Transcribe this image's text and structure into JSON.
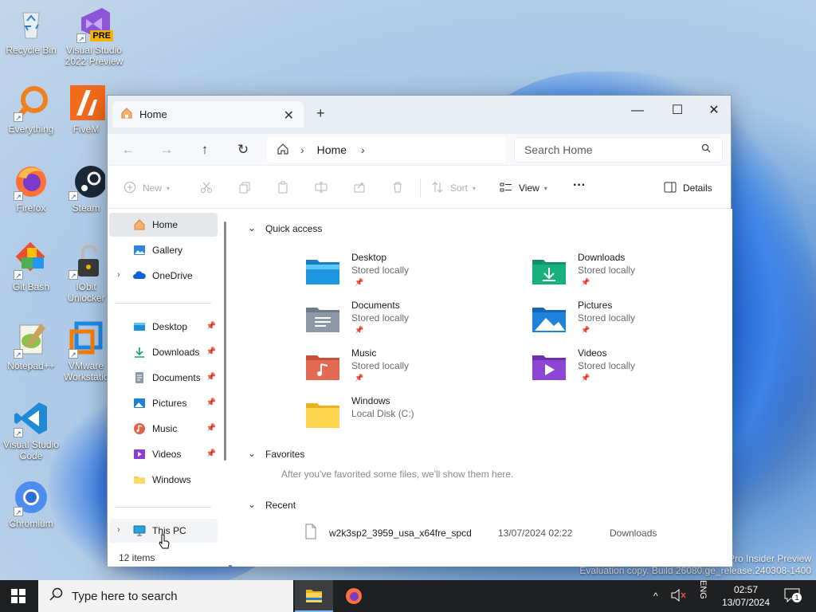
{
  "desktop": {
    "icons": [
      {
        "label": "Recycle Bin",
        "icon": "recycle-bin-icon"
      },
      {
        "label": "Visual Studio 2022 Preview",
        "icon": "visual-studio-icon",
        "badge": "PRE"
      },
      {
        "label": "Everything",
        "icon": "everything-icon"
      },
      {
        "label": "FiveM",
        "icon": "fivem-icon"
      },
      {
        "label": "Firefox",
        "icon": "firefox-icon"
      },
      {
        "label": "Steam",
        "icon": "steam-icon"
      },
      {
        "label": "Git Bash",
        "icon": "git-bash-icon"
      },
      {
        "label": "IObit Unlocker",
        "icon": "iobit-unlocker-icon"
      },
      {
        "label": "Notepad++",
        "icon": "notepad-plus-icon"
      },
      {
        "label": "VMware Workstation",
        "icon": "vmware-icon"
      },
      {
        "label": "Visual Studio Code",
        "icon": "vscode-icon"
      },
      {
        "label": "Chromium",
        "icon": "chromium-icon"
      }
    ],
    "watermark_line1": "Pro Insider Preview",
    "watermark_line2": "Evaluation copy. Build 26080.ge_release.240308-1400"
  },
  "explorer": {
    "tab_title": "Home",
    "new_tab": "+",
    "address_location": "Home",
    "search_placeholder": "Search Home",
    "toolbar": {
      "new_label": "New",
      "sort_label": "Sort",
      "view_label": "View",
      "more_label": "···",
      "details_label": "Details"
    },
    "sidebar": {
      "home": "Home",
      "gallery": "Gallery",
      "onedrive": "OneDrive",
      "desktop": "Desktop",
      "downloads": "Downloads",
      "documents": "Documents",
      "pictures": "Pictures",
      "music": "Music",
      "videos": "Videos",
      "windows": "Windows",
      "this_pc": "This PC"
    },
    "status_text": "12 items",
    "quick_access": {
      "header": "Quick access",
      "items": [
        {
          "name": "Desktop",
          "sub": "Stored locally",
          "pinned": true
        },
        {
          "name": "Downloads",
          "sub": "Stored locally",
          "pinned": true
        },
        {
          "name": "Documents",
          "sub": "Stored locally",
          "pinned": true
        },
        {
          "name": "Pictures",
          "sub": "Stored locally",
          "pinned": true
        },
        {
          "name": "Music",
          "sub": "Stored locally",
          "pinned": true
        },
        {
          "name": "Videos",
          "sub": "Stored locally",
          "pinned": true
        },
        {
          "name": "Windows",
          "sub": "Local Disk (C:)",
          "pinned": false
        }
      ]
    },
    "favorites": {
      "header": "Favorites",
      "empty_text": "After you've favorited some files, we'll show them here."
    },
    "recent": {
      "header": "Recent",
      "items": [
        {
          "name": "w2k3sp2_3959_usa_x64fre_spcd",
          "date": "13/07/2024 02:22",
          "location": "Downloads"
        }
      ]
    }
  },
  "taskbar": {
    "search_placeholder": "Type here to search",
    "language": "ENG",
    "time": "02:57",
    "date": "13/07/2024",
    "notification_count": "1"
  }
}
